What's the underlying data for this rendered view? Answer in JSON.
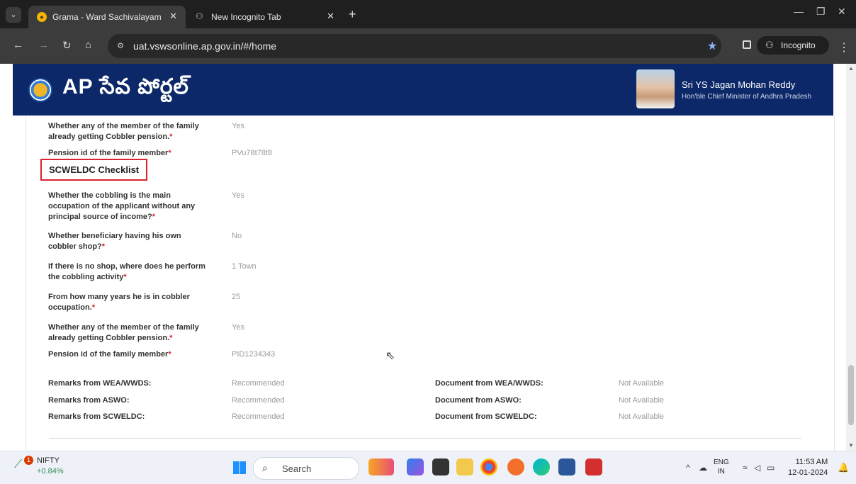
{
  "browser": {
    "tabs": [
      {
        "title": "Grama - Ward Sachivalayam",
        "active": true
      },
      {
        "title": "New Incognito Tab",
        "active": false
      }
    ],
    "url": "uat.vswsonline.ap.gov.in/#/home",
    "incognito_label": "Incognito"
  },
  "header": {
    "brand": "AP సేవ పోర్టల్",
    "cm_name": "Sri YS Jagan Mohan Reddy",
    "cm_role": "Hon'ble Chief Minister of Andhra Pradesh"
  },
  "details": {
    "top_rows": [
      {
        "label": "Whether any of the member of the family already getting Cobbler pension.",
        "value": "Yes"
      },
      {
        "label": "Pension id of the family member",
        "value": "PVu78t78t8"
      }
    ],
    "section_title": "SCWELDC Checklist",
    "checklist": [
      {
        "label": "Whether the cobbling is the main occupation of the applicant without any principal source of income?",
        "value": "Yes"
      },
      {
        "label": "Whether beneficiary having his own cobbler shop?",
        "value": "No"
      },
      {
        "label": "If there is no shop, where does he perform the cobbling activity",
        "value": "1 Town"
      },
      {
        "label": "From how many years he is in cobbler occupation.",
        "value": "25"
      },
      {
        "label": "Whether any of the member of the family already getting Cobbler pension.",
        "value": "Yes"
      },
      {
        "label": "Pension id of the family member",
        "value": "PID1234343"
      }
    ],
    "remarks": [
      {
        "label": "Remarks from WEA/WWDS:",
        "value": "Recommended",
        "doc_label": "Document from WEA/WWDS:",
        "doc_value": "Not Available"
      },
      {
        "label": "Remarks from ASWO:",
        "value": "Recommended",
        "doc_label": "Document from ASWO:",
        "doc_value": "Not Available"
      },
      {
        "label": "Remarks from SCWELDC:",
        "value": "Recommended",
        "doc_label": "Document from SCWELDC:",
        "doc_value": "Not Available"
      }
    ]
  },
  "taskbar": {
    "nifty_name": "NIFTY",
    "nifty_change": "+0.84%",
    "nifty_badge": "1",
    "search_label": "Search",
    "lang_line1": "ENG",
    "lang_line2": "IN",
    "time": "11:53 AM",
    "date": "12-01-2024"
  },
  "colors": {
    "header_bg": "#0c2869",
    "required": "#d9232e",
    "section_border": "#d9232e"
  }
}
